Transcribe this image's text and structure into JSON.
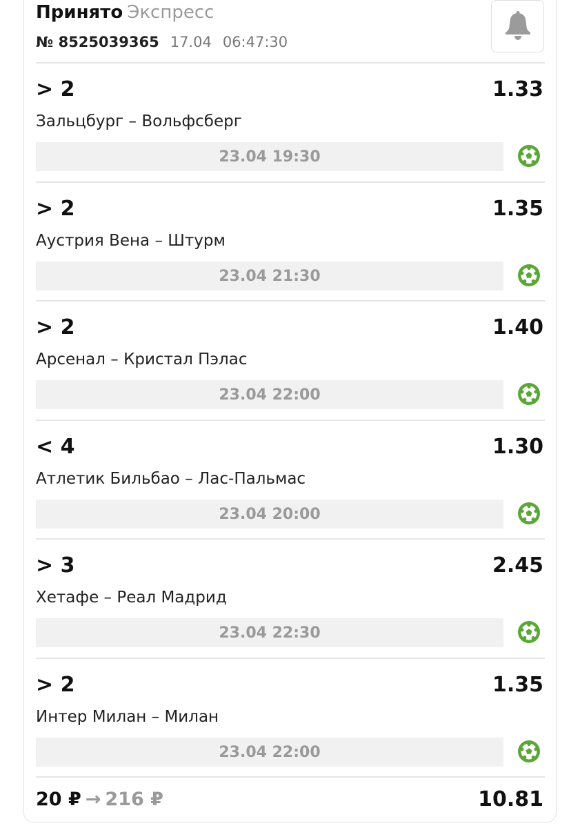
{
  "header": {
    "status": "Принято",
    "bet_type": "Экспресс",
    "bet_number": "№ 8525039365",
    "date": "17.04",
    "time": "06:47:30",
    "bell_icon": "bell-icon"
  },
  "events": [
    {
      "market": "> 2",
      "odds": "1.33",
      "teams": "Зальцбург – Вольфсберг",
      "datetime": "23.04 19:30",
      "sport_icon": "football-icon"
    },
    {
      "market": "> 2",
      "odds": "1.35",
      "teams": "Аустрия Вена – Штурм",
      "datetime": "23.04 21:30",
      "sport_icon": "football-icon"
    },
    {
      "market": "> 2",
      "odds": "1.40",
      "teams": "Арсенал – Кристал Пэлас",
      "datetime": "23.04 22:00",
      "sport_icon": "football-icon"
    },
    {
      "market": "< 4",
      "odds": "1.30",
      "teams": "Атлетик Бильбао – Лас-Пальмас",
      "datetime": "23.04 20:00",
      "sport_icon": "football-icon"
    },
    {
      "market": "> 3",
      "odds": "2.45",
      "teams": "Хетафе – Реал Мадрид",
      "datetime": "23.04 22:30",
      "sport_icon": "football-icon"
    },
    {
      "market": "> 2",
      "odds": "1.35",
      "teams": "Интер Милан – Милан",
      "datetime": "23.04 22:00",
      "sport_icon": "football-icon"
    }
  ],
  "footer": {
    "stake": "20 ₽",
    "arrow": "→",
    "potential_win": "216 ₽",
    "total_odds": "10.81"
  },
  "colors": {
    "accent_green": "#5aa637",
    "muted_gray": "#9a9a9a",
    "date_bar_bg": "#f1f1f1"
  }
}
